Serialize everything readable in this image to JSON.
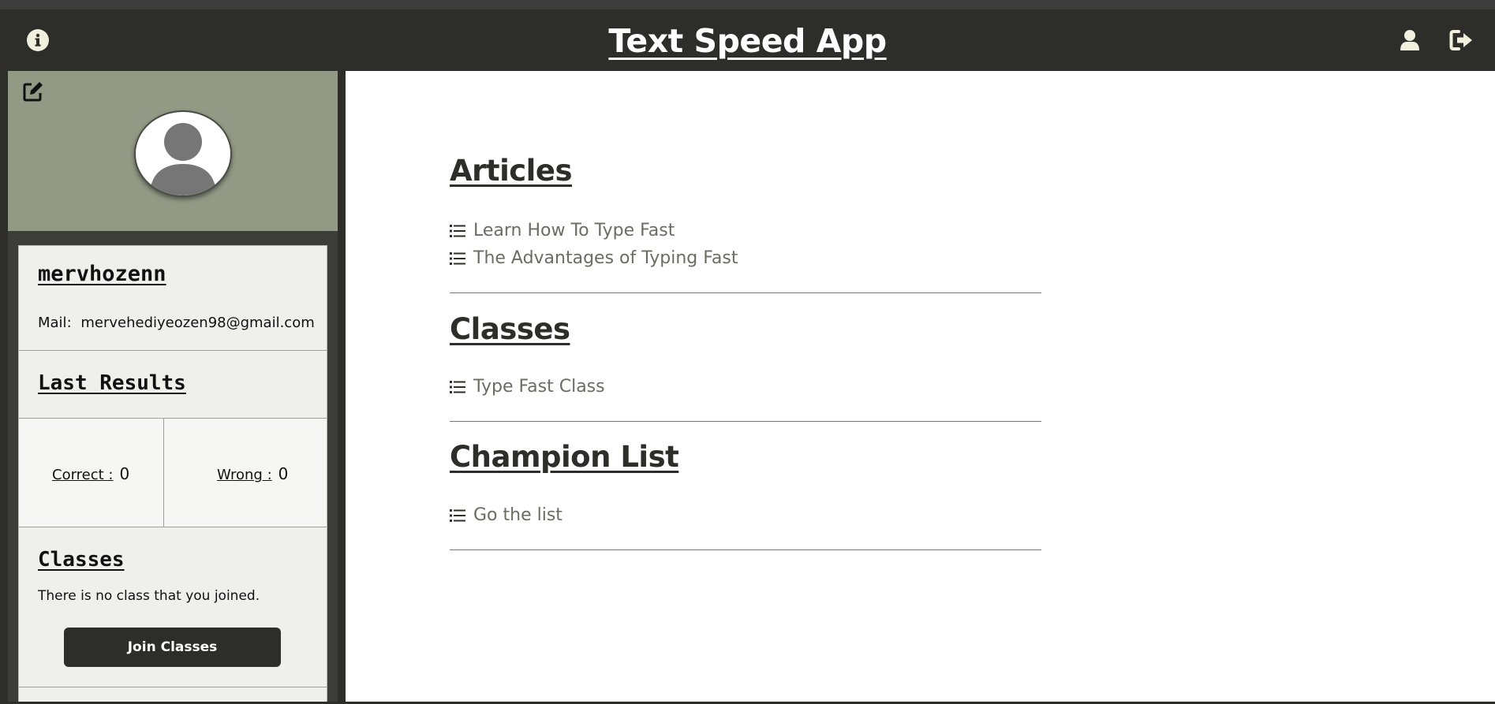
{
  "app": {
    "title": "Text Speed App"
  },
  "navbar": {
    "info_icon": "info-circle-icon",
    "user_icon": "user-icon",
    "logout_icon": "sign-out-icon"
  },
  "profile": {
    "edit_icon": "edit-icon",
    "avatar_icon": "user-avatar-icon",
    "username": "mervhozenn",
    "mail_label": "Mail:",
    "mail_value": "mervehediyeozen98@gmail.com"
  },
  "last_results": {
    "title": "Last Results",
    "correct_label": "Correct :",
    "correct_value": "0",
    "wrong_label": "Wrong :",
    "wrong_value": "0"
  },
  "classes_panel": {
    "title": "Classes",
    "empty_text": "There is no class that you joined.",
    "join_label": "Join Classes"
  },
  "main": {
    "articles": {
      "title": "Articles",
      "items": [
        "Learn How To Type Fast",
        "The Advantages of Typing Fast"
      ]
    },
    "classes": {
      "title": "Classes",
      "items": [
        "Type Fast Class"
      ]
    },
    "champion": {
      "title": "Champion List",
      "items": [
        "Go the list"
      ]
    },
    "list_icon": "list-icon"
  },
  "colors": {
    "navbar": "#2d2e2a",
    "profile_header": "#929a85",
    "card_bg": "#eff0ec",
    "link_text": "#6a6d61",
    "button_bg": "#2d2e2c"
  }
}
